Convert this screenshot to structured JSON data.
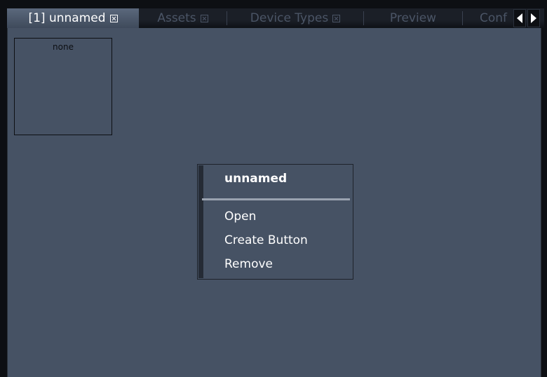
{
  "tabs": [
    {
      "label": "[1] unnamed",
      "closable": true,
      "active": true
    },
    {
      "label": "Assets",
      "closable": true,
      "active": false
    },
    {
      "label": "Device Types",
      "closable": true,
      "active": false
    },
    {
      "label": "Preview",
      "closable": false,
      "active": false
    },
    {
      "label": "Conf",
      "closable": false,
      "active": false
    }
  ],
  "thumbnail": {
    "label": "none"
  },
  "context_menu": {
    "title": "unnamed",
    "items": [
      "Open",
      "Create Button",
      "Remove"
    ]
  },
  "colors": {
    "background": "#465264",
    "frame": "#0d0f13",
    "text": "#ffffff",
    "inactive_tab_text": "#4b5566"
  }
}
